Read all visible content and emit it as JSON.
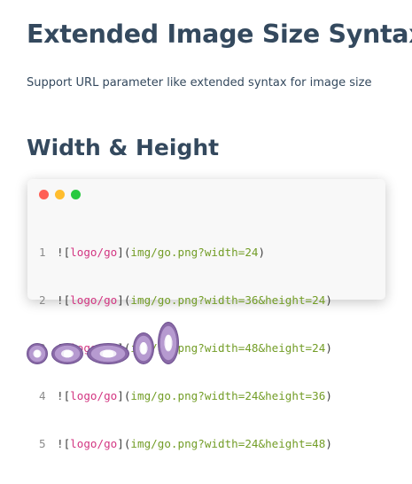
{
  "page": {
    "title": "Extended Image Size Syntax",
    "description": "Support URL parameter like extended syntax for image size",
    "section_title": "Width & Height"
  },
  "code_block": {
    "lines": [
      {
        "num": "1",
        "open": "![",
        "alt": "logo/go",
        "mid": "](",
        "url": "img/go.png?width=24",
        "close": ")"
      },
      {
        "num": "2",
        "open": "![",
        "alt": "logo/go",
        "mid": "](",
        "url": "img/go.png?width=36&height=24",
        "close": ")"
      },
      {
        "num": "3",
        "open": "![",
        "alt": "logo/go",
        "mid": "](",
        "url": "img/go.png?width=48&height=24",
        "close": ")"
      },
      {
        "num": "4",
        "open": "![",
        "alt": "logo/go",
        "mid": "](",
        "url": "img/go.png?width=24&height=36",
        "close": ")"
      },
      {
        "num": "5",
        "open": "![",
        "alt": "logo/go",
        "mid": "](",
        "url": "img/go.png?width=24&height=48",
        "close": ")"
      }
    ]
  },
  "images": [
    {
      "alt": "logo/go",
      "icon": "go-gopher-logo"
    },
    {
      "alt": "logo/go",
      "icon": "go-gopher-logo"
    },
    {
      "alt": "logo/go",
      "icon": "go-gopher-logo"
    },
    {
      "alt": "logo/go",
      "icon": "go-gopher-logo"
    },
    {
      "alt": "logo/go",
      "icon": "go-gopher-logo"
    }
  ],
  "colors": {
    "heading": "#34495e",
    "code_bg": "#f8f8f8",
    "alt_text": "#d33682",
    "url_text": "#739d27",
    "dot_red": "#ff5f56",
    "dot_yellow": "#ffbd2e",
    "dot_green": "#27c93f"
  }
}
